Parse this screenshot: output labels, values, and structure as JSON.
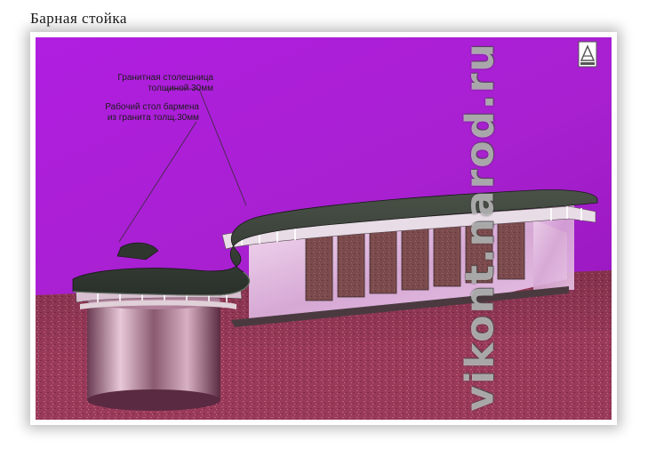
{
  "page": {
    "title": "Барная  стойка"
  },
  "annotations": {
    "countertop": [
      "Гранитная столешница",
      "толщиной 30мм"
    ],
    "bartender_table": [
      "Рабочий стол бармена",
      "из гранита толщ.30мм"
    ]
  },
  "watermark": {
    "text": "vikont.narod.ru"
  },
  "colors": {
    "backdrop": "#b020d8",
    "floor": "#a04060",
    "counter_top": "#3a4238",
    "granite_panel": "#7a4848",
    "chrome": "#c8a8c8"
  }
}
